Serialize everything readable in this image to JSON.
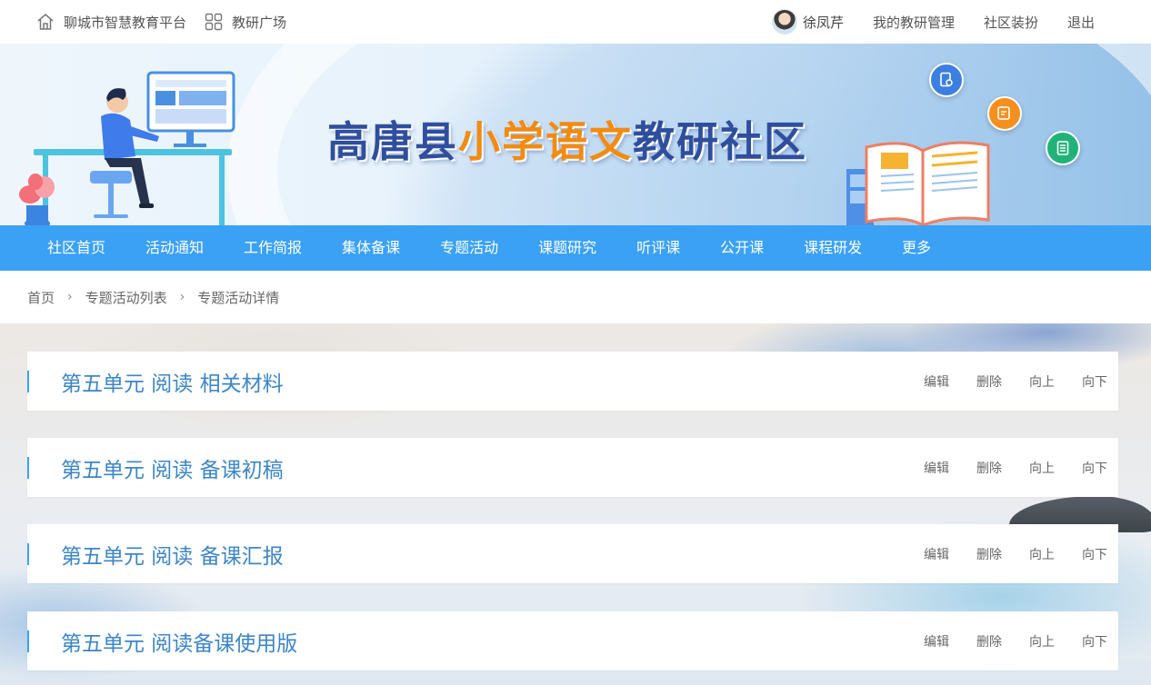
{
  "topbar": {
    "platform_name": "聊城市智慧教育平台",
    "square_name": "教研广场",
    "user_name": "徐凤芹",
    "links": [
      "我的教研管理",
      "社区装扮",
      "退出"
    ]
  },
  "banner": {
    "title_prefix": "高唐县",
    "title_highlight": "小学语文",
    "title_suffix": "教研社区"
  },
  "nav": {
    "items": [
      "社区首页",
      "活动通知",
      "工作简报",
      "集体备课",
      "专题活动",
      "课题研究",
      "听评课",
      "公开课",
      "课程研发",
      "更多"
    ]
  },
  "breadcrumb": {
    "items": [
      "首页",
      "专题活动列表",
      "专题活动详情"
    ],
    "separator": "›"
  },
  "rows": [
    {
      "title": "第五单元 阅读 相关材料"
    },
    {
      "title": "第五单元 阅读 备课初稿"
    },
    {
      "title": "第五单元 阅读 备课汇报"
    },
    {
      "title": "第五单元 阅读备课使用版"
    }
  ],
  "row_actions": {
    "edit": "编辑",
    "delete": "删除",
    "up": "向上",
    "down": "向下"
  },
  "colors": {
    "accent": "#3ba1f5",
    "title_blue": "#2f4e9e",
    "title_orange": "#f28b12",
    "row_title": "#3d86c6"
  }
}
